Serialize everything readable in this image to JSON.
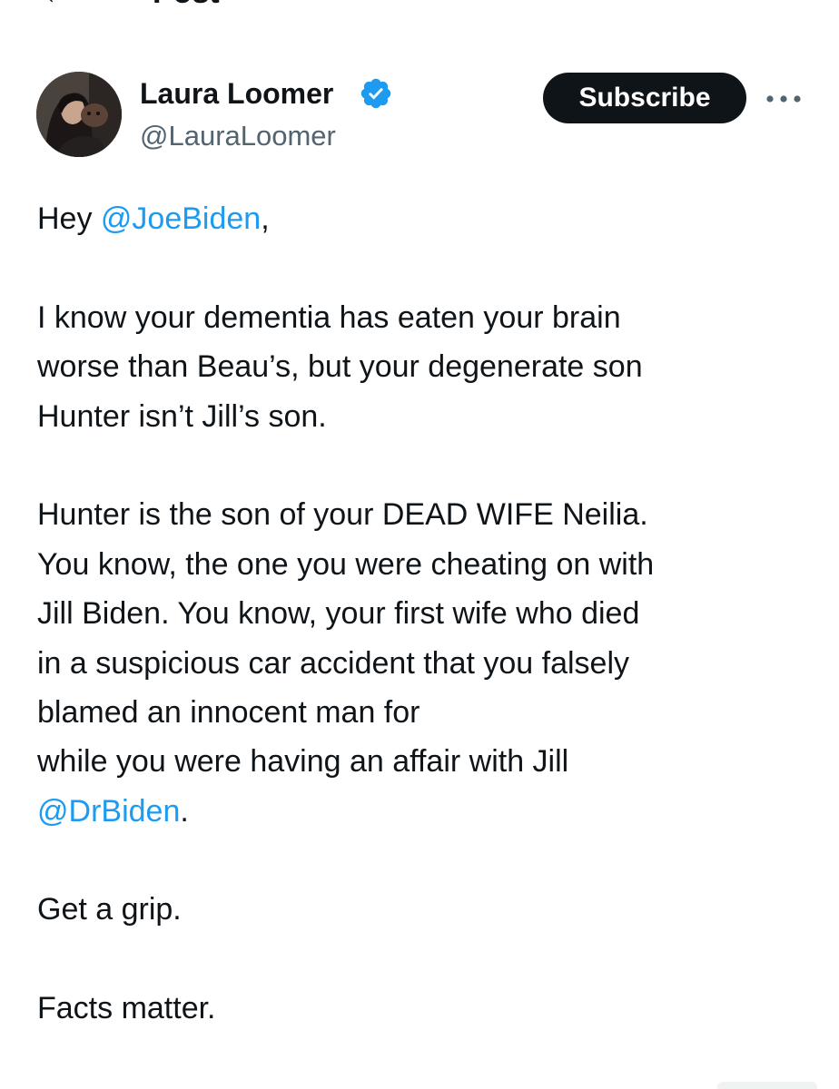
{
  "header": {
    "back_icon": "arrow-left-icon",
    "title": "Post"
  },
  "author": {
    "name": "Laura Loomer",
    "handle": "@LauraLoomer",
    "verified_icon": "verified-badge-icon",
    "verified_color": "#1d9bf0"
  },
  "actions": {
    "subscribe_label": "Subscribe",
    "more_icon": "more-horizontal-icon"
  },
  "post": {
    "greeting_prefix": "Hey ",
    "mention_joe": "@JoeBiden",
    "greeting_suffix": ",",
    "line1": "I know your dementia has eaten your brain",
    "line2": "worse than Beau’s, but your degenerate son",
    "line3": "Hunter isn’t Jill’s son.",
    "line4": "Hunter is the son of your DEAD WIFE Neilia.",
    "line5": "You know, the one you were cheating on with",
    "line6": "Jill Biden. You know, your first wife who died",
    "line7": "in a suspicious car accident that you falsely",
    "line8": "blamed an innocent man for",
    "line9": "while you were having an affair with Jill",
    "mention_dr": "@DrBiden",
    "mention_dr_suffix": ".",
    "line10": "Get a grip.",
    "line11": "Facts matter."
  },
  "colors": {
    "text": "#0f1419",
    "secondary": "#536471",
    "link": "#1d9bf0",
    "button_bg": "#0f1419"
  }
}
